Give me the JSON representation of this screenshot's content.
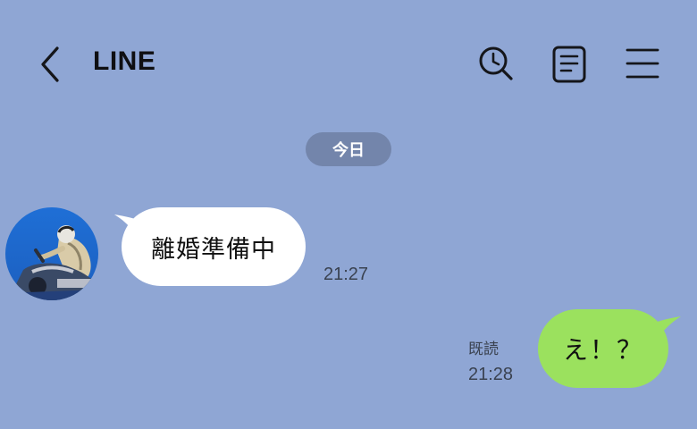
{
  "header": {
    "title": "LINE",
    "icons": [
      "back-chevron-icon",
      "search-clock-icon",
      "notes-icon",
      "menu-icon"
    ]
  },
  "date_separator": "今日",
  "messages": [
    {
      "direction": "incoming",
      "text": "離婚準備中",
      "time": "21:27",
      "avatar": "avatar-photo-motorcycle-rider"
    },
    {
      "direction": "outgoing",
      "text": "え！？",
      "read": "既読",
      "time": "21:28"
    }
  ],
  "colors": {
    "background": "#8fa6d4",
    "incoming_bubble": "#ffffff",
    "outgoing_bubble": "#9be15e",
    "date_pill": "#7385ab"
  }
}
